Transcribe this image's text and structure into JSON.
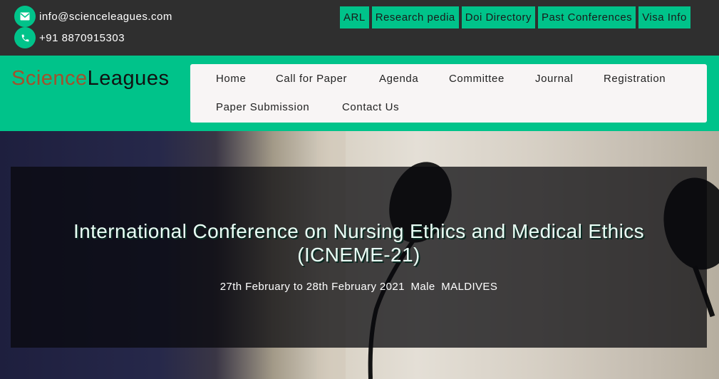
{
  "contact": {
    "email": "info@scienceleagues.com",
    "phone": "+91 8870915303",
    "email_icon": "envelope-icon",
    "phone_icon": "phone-icon"
  },
  "top_links": [
    "ARL",
    "Research pedia",
    "Doi Directory",
    "Past Conferences",
    "Visa Info"
  ],
  "logo": {
    "part1": "Science",
    "part2": "Leagues"
  },
  "nav": {
    "home": "Home",
    "call_for_paper": "Call for Paper",
    "agenda": "Agenda",
    "committee": "Committee",
    "journal": "Journal",
    "registration": "Registration",
    "paper_submission": "Paper Submission",
    "contact_us": "Contact Us"
  },
  "hero": {
    "title_line1": "International Conference on Nursing Ethics and Medical Ethics",
    "title_line2": "(ICNEME-21)",
    "dates": "27th February to 28th February 2021",
    "city": "Male",
    "country": "MALDIVES"
  },
  "colors": {
    "accent": "#00c38a",
    "topbar": "#2f2f2f",
    "logo_part1": "#a0522d",
    "logo_part2": "#111111"
  }
}
